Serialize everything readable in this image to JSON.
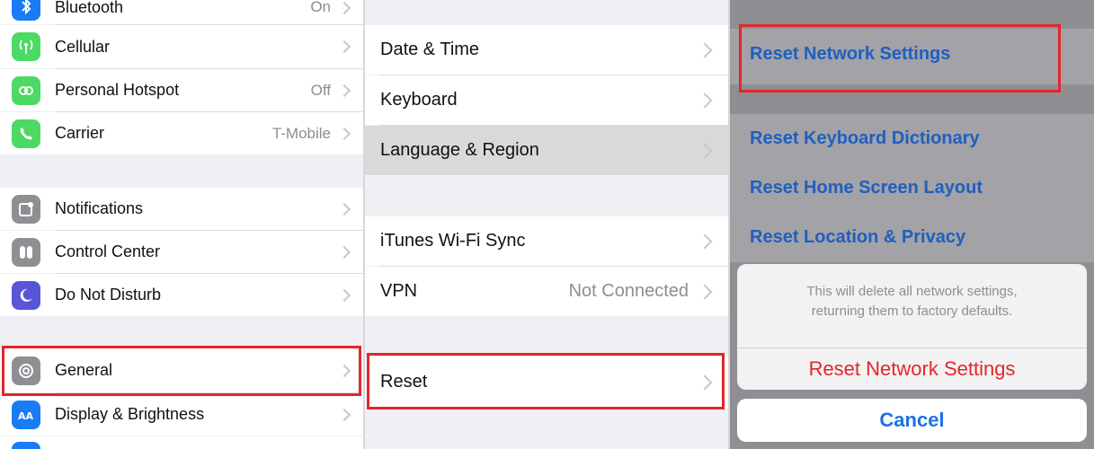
{
  "settings": {
    "group1": [
      {
        "label": "Bluetooth",
        "value": "On",
        "icon": "bluetooth-icon"
      },
      {
        "label": "Cellular",
        "value": "",
        "icon": "cellular-icon"
      },
      {
        "label": "Personal Hotspot",
        "value": "Off",
        "icon": "hotspot-icon"
      },
      {
        "label": "Carrier",
        "value": "T-Mobile",
        "icon": "phone-icon"
      }
    ],
    "group2": [
      {
        "label": "Notifications",
        "icon": "notifications-icon"
      },
      {
        "label": "Control Center",
        "icon": "control-center-icon"
      },
      {
        "label": "Do Not Disturb",
        "icon": "moon-icon"
      }
    ],
    "group3": [
      {
        "label": "General",
        "icon": "gear-icon"
      },
      {
        "label": "Display & Brightness",
        "icon": "display-icon"
      }
    ]
  },
  "general": {
    "group1": [
      {
        "label": "Date & Time",
        "value": ""
      },
      {
        "label": "Keyboard",
        "value": ""
      },
      {
        "label": "Language & Region",
        "value": ""
      }
    ],
    "group2": [
      {
        "label": "iTunes Wi-Fi Sync",
        "value": ""
      },
      {
        "label": "VPN",
        "value": "Not Connected"
      }
    ],
    "group3": [
      {
        "label": "Reset",
        "value": ""
      }
    ]
  },
  "reset": {
    "items": [
      "Reset Network Settings",
      "Reset Keyboard Dictionary",
      "Reset Home Screen Layout",
      "Reset Location & Privacy"
    ],
    "sheet": {
      "message_line1": "This will delete all network settings,",
      "message_line2": "returning them to factory defaults.",
      "confirm_label": "Reset Network Settings",
      "cancel_label": "Cancel"
    }
  },
  "colors": {
    "highlight": "#e3262b",
    "link_blue": "#1f5fbf",
    "destructive_red": "#e3262b",
    "cancel_blue": "#1a73e8"
  }
}
